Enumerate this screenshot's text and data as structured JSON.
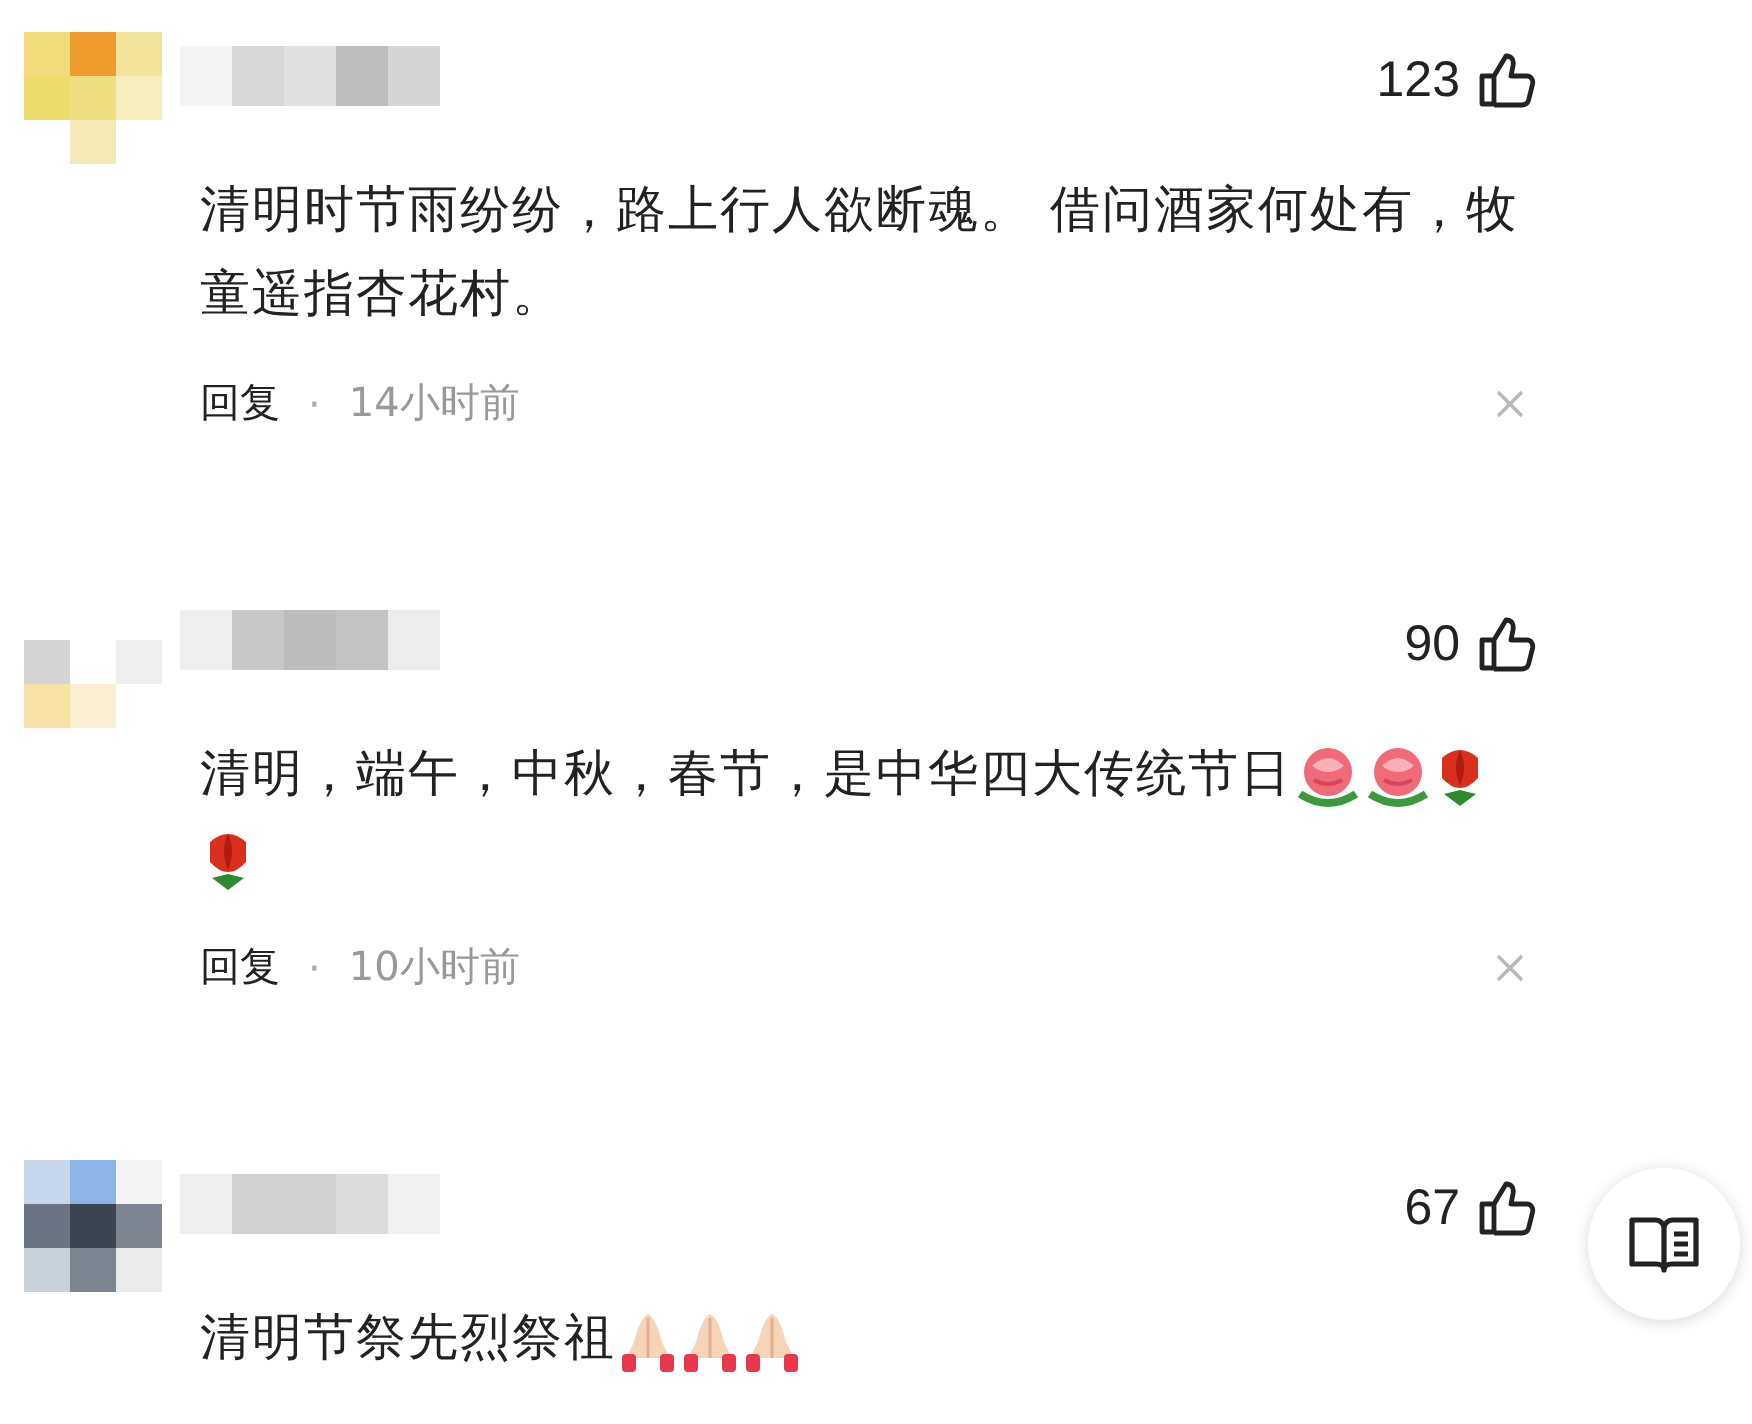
{
  "comments": [
    {
      "likes": "123",
      "text": "清明时节雨纷纷，路上行人欲断魂。 借问酒家何处有，牧童遥指杏花村。",
      "reply": "回复",
      "separator": "·",
      "time": "14小时前"
    },
    {
      "likes": "90",
      "text": "清明，端午，中秋，春节，是中华四大传统节日",
      "emojis": [
        {
          "kind": "rose"
        },
        {
          "kind": "rose"
        },
        {
          "kind": "tulip"
        },
        {
          "kind": "tulip"
        }
      ],
      "reply": "回复",
      "separator": "·",
      "time": "10小时前"
    },
    {
      "likes": "67",
      "text": "清明节祭先烈祭祖",
      "emojis": [
        {
          "kind": "praying"
        },
        {
          "kind": "praying"
        },
        {
          "kind": "praying"
        }
      ]
    }
  ]
}
